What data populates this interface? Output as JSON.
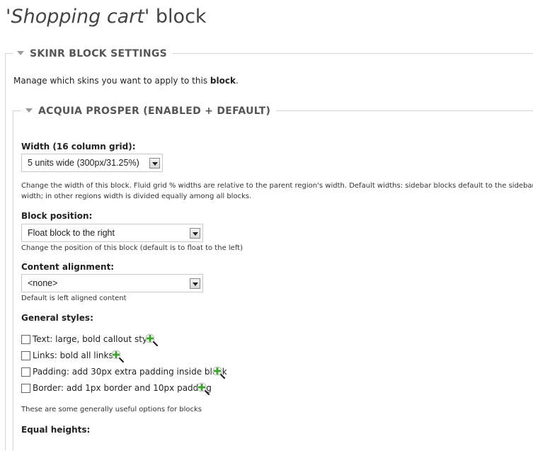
{
  "page": {
    "title_prefix": "'",
    "title_italic": "Shopping cart",
    "title_suffix": "' block"
  },
  "skinr": {
    "legend": "SKINR BLOCK SETTINGS",
    "intro_before": "Manage which skins you want to apply to this ",
    "intro_bold": "block",
    "intro_after": "."
  },
  "prosper": {
    "legend": "ACQUIA PROSPER (ENABLED + DEFAULT)",
    "width": {
      "label": "Width (16 column grid):",
      "value": "5 units wide (300px/31.25%)",
      "desc_line1": "Change the width of this block. Fluid grid % widths are relative to the parent region's width. Default widths: sidebar blocks default to the sidebar",
      "desc_line2": "width; in other regions width is divided equally among all blocks."
    },
    "position": {
      "label": "Block position:",
      "value": "Float block to the right",
      "desc": "Change the position of this block (default is to float to the left)"
    },
    "alignment": {
      "label": "Content alignment:",
      "value": "<none>",
      "desc": "Default is left aligned content"
    },
    "general": {
      "label": "General styles:",
      "options": [
        {
          "label": "Text: large, bold callout style",
          "checked": false
        },
        {
          "label": "Links: bold all links",
          "checked": false
        },
        {
          "label": "Padding: add 30px extra padding inside block",
          "checked": false
        },
        {
          "label": "Border: add 1px border and 10px padding",
          "checked": false
        }
      ],
      "desc": "These are some generally useful options for blocks"
    },
    "equal_heights": {
      "label": "Equal heights:"
    }
  },
  "icons": {
    "zoom": "zoom-in-magnifier-icon",
    "collapse": "triangle-down-icon"
  },
  "colors": {
    "zoom_plus": "#3aa52a",
    "legend_text": "#555555",
    "title_text": "#444444"
  }
}
